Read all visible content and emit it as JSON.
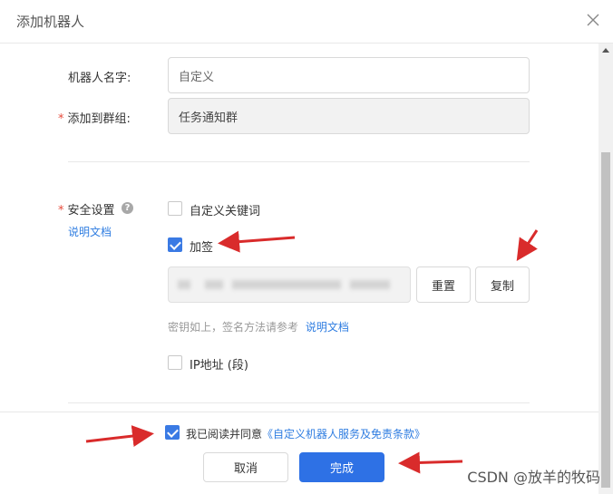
{
  "dialog": {
    "title": "添加机器人"
  },
  "form": {
    "name_label": "机器人名字:",
    "name_value": "自定义",
    "group_label": "添加到群组:",
    "group_value": "任务通知群",
    "security_label": "安全设置",
    "doc_link": "说明文档",
    "keyword_label": "自定义关键词",
    "keyword_checked": false,
    "sign_label": "加签",
    "sign_checked": true,
    "reset_label": "重置",
    "copy_label": "复制",
    "hint_text": "密钥如上，签名方法请参考",
    "hint_link": "说明文档",
    "ip_label": "IP地址 (段)",
    "ip_checked": false
  },
  "footer": {
    "agree_text": "我已阅读并同意",
    "agree_link": "《自定义机器人服务及免责条款》",
    "agree_checked": true,
    "cancel_label": "取消",
    "done_label": "完成"
  },
  "watermark": "CSDN @放羊的牧码",
  "colors": {
    "primary": "#2e71e5",
    "link": "#2f7de1",
    "required": "#e74c3c",
    "arrow": "#d92b2b"
  }
}
